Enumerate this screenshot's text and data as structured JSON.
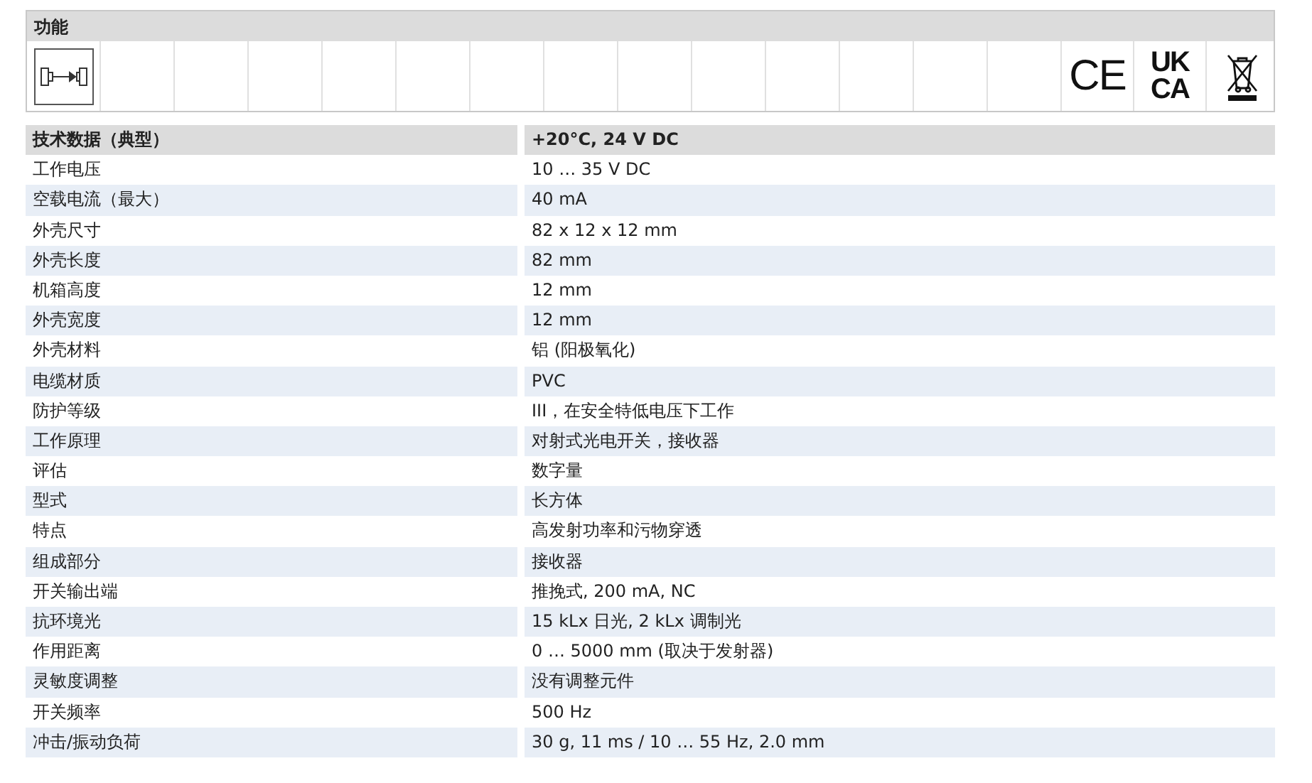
{
  "function_panel": {
    "title": "功能",
    "cells": [
      {
        "kind": "symbol"
      },
      {
        "kind": "empty"
      },
      {
        "kind": "empty"
      },
      {
        "kind": "empty"
      },
      {
        "kind": "empty"
      },
      {
        "kind": "empty"
      },
      {
        "kind": "empty"
      },
      {
        "kind": "empty"
      },
      {
        "kind": "empty"
      },
      {
        "kind": "empty"
      },
      {
        "kind": "empty"
      },
      {
        "kind": "empty"
      },
      {
        "kind": "empty"
      },
      {
        "kind": "empty"
      },
      {
        "kind": "mark",
        "lines": [
          "CE"
        ]
      },
      {
        "kind": "mark",
        "lines": [
          "UK",
          "CA"
        ]
      },
      {
        "kind": "bin"
      }
    ]
  },
  "table": {
    "columns": [
      "技术数据（典型）",
      "+20°C, 24 V DC"
    ],
    "rows": [
      [
        "工作电压",
        "10 … 35 V DC"
      ],
      [
        "空载电流（最大）",
        "40 mA"
      ],
      [
        "外壳尺寸",
        "82 x 12 x 12 mm"
      ],
      [
        "外壳长度",
        "82 mm"
      ],
      [
        "机箱高度",
        "12 mm"
      ],
      [
        "外壳宽度",
        "12 mm"
      ],
      [
        "外壳材料",
        "铝 (阳极氧化)"
      ],
      [
        "电缆材质",
        "PVC"
      ],
      [
        "防护等级",
        "III，在安全特低电压下工作"
      ],
      [
        "工作原理",
        "对射式光电开关，接收器"
      ],
      [
        "评估",
        "数字量"
      ],
      [
        "型式",
        "长方体"
      ],
      [
        "特点",
        "高发射功率和污物穿透"
      ],
      [
        "组成部分",
        "接收器"
      ],
      [
        "开关输出端",
        "推挽式, 200 mA, NC"
      ],
      [
        "抗环境光",
        "15 kLx 日光, 2 kLx 调制光"
      ],
      [
        "作用距离",
        "0 … 5000 mm (取决于发射器)"
      ],
      [
        "灵敏度调整",
        "没有调整元件"
      ],
      [
        "开关频率",
        "500 Hz"
      ],
      [
        "冲击/振动负荷",
        "30 g, 11 ms / 10 … 55 Hz, 2.0 mm"
      ]
    ]
  }
}
